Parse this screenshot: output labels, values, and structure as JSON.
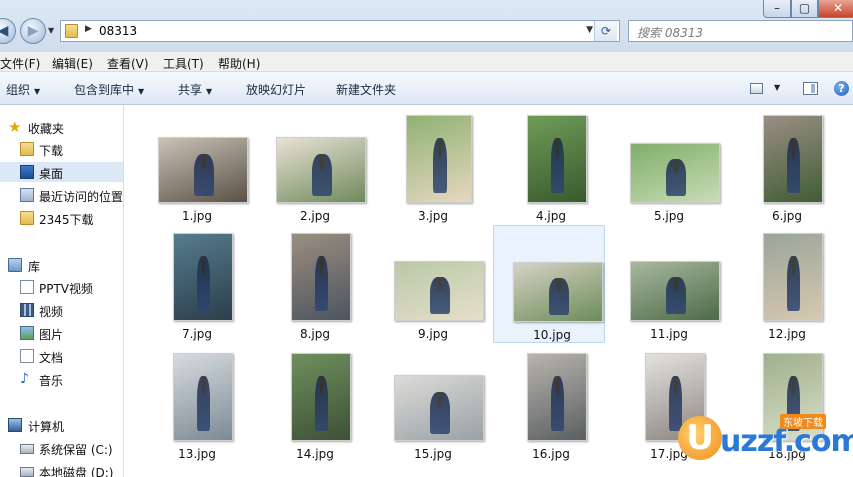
{
  "window": {
    "address_path": "08313",
    "search_placeholder": "搜索 08313"
  },
  "menu": [
    "文件(F)",
    "编辑(E)",
    "查看(V)",
    "工具(T)",
    "帮助(H)"
  ],
  "toolbar": [
    {
      "label": "组织",
      "dropdown": true
    },
    {
      "label": "包含到库中",
      "dropdown": true
    },
    {
      "label": "共享",
      "dropdown": true
    },
    {
      "label": "放映幻灯片",
      "dropdown": false
    },
    {
      "label": "新建文件夹",
      "dropdown": false
    }
  ],
  "nav": {
    "favorites": {
      "label": "收藏夹",
      "items": [
        "下载",
        "桌面",
        "最近访问的位置",
        "2345下载"
      ]
    },
    "libraries": {
      "label": "库",
      "items": [
        "PPTV视频",
        "视频",
        "图片",
        "文档",
        "音乐"
      ]
    },
    "computer": {
      "label": "计算机",
      "items": [
        "系统保留 (C:)",
        "本地磁盘 (D:)"
      ]
    }
  },
  "files": [
    {
      "name": "1.jpg"
    },
    {
      "name": "2.jpg"
    },
    {
      "name": "3.jpg"
    },
    {
      "name": "4.jpg"
    },
    {
      "name": "5.jpg"
    },
    {
      "name": "6.jpg"
    },
    {
      "name": "7.jpg"
    },
    {
      "name": "8.jpg"
    },
    {
      "name": "9.jpg"
    },
    {
      "name": "10.jpg"
    },
    {
      "name": "11.jpg"
    },
    {
      "name": "12.jpg"
    },
    {
      "name": "13.jpg"
    },
    {
      "name": "14.jpg"
    },
    {
      "name": "15.jpg"
    },
    {
      "name": "16.jpg"
    },
    {
      "name": "17.jpg"
    },
    {
      "name": "18.jpg"
    }
  ],
  "watermark": {
    "brand": "uzzf.com",
    "tag": "东坡下载"
  },
  "colors": {
    "selection": "#dce8f6",
    "toolbar_text": "#1a2a44",
    "close_button": "#c8432c"
  }
}
